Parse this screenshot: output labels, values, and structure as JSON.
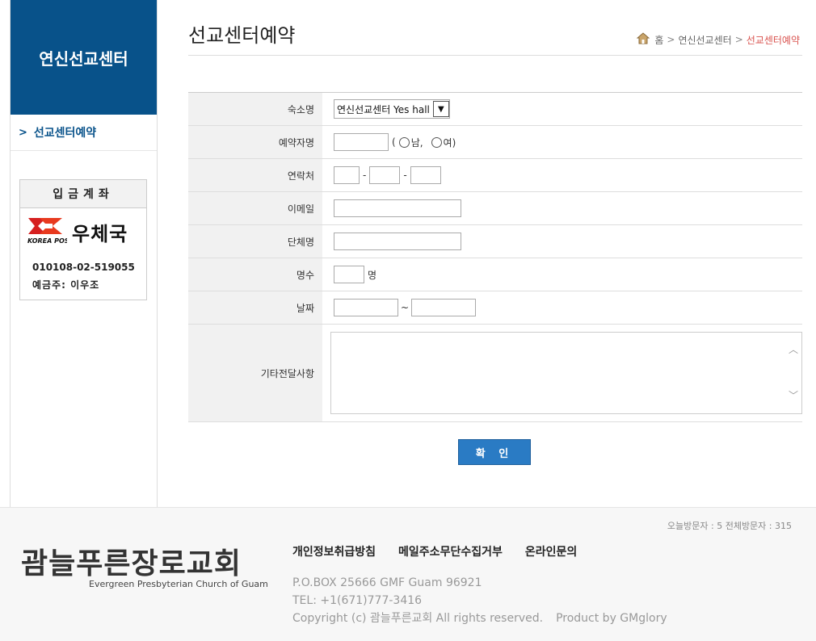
{
  "sidebar": {
    "title": "연신선교센터",
    "menu_item": "선교센터예약",
    "account": {
      "title": "입금계좌",
      "bank_name": "우체국",
      "bank_sub": "KOREA POST",
      "number": "010108-02-519055",
      "holder": "예금주: 이우조"
    }
  },
  "header": {
    "title": "선교센터예약",
    "breadcrumb": [
      "홈",
      "연신선교센터",
      "선교센터예약"
    ]
  },
  "form": {
    "lodging": {
      "label": "숙소명",
      "value": "연신선교센터 Yes hall"
    },
    "reserver": {
      "label": "예약자명",
      "open_paren": "(",
      "male": "남,",
      "female": "여)"
    },
    "contact": {
      "label": "연락처",
      "dash": "-"
    },
    "email": {
      "label": "이메일"
    },
    "group": {
      "label": "단체명"
    },
    "count": {
      "label": "명수",
      "unit": "명"
    },
    "date": {
      "label": "날짜",
      "tilde": "~"
    },
    "notes": {
      "label": "기타전달사항"
    },
    "submit": "확 인"
  },
  "footer": {
    "visitors": "오늘방문자 : 5    전체방문자 : 315",
    "logo_kr": "괌늘푸른장로교회",
    "logo_en": "Evergreen Presbyterian Church of Guam",
    "links": [
      "개인정보취급방침",
      "메일주소무단수집거부",
      "온라인문의"
    ],
    "address": "P.O.BOX 25666 GMF Guam 96921",
    "tel": "TEL: +1(671)777-3416",
    "copyright": "Copyright (c) 괌늘푸른교회 All rights reserved.",
    "product": "Product by GMglory"
  },
  "colors": {
    "brand": "#08528a",
    "button": "#2a7bc4",
    "breadcrumb_current": "#d9534f"
  }
}
